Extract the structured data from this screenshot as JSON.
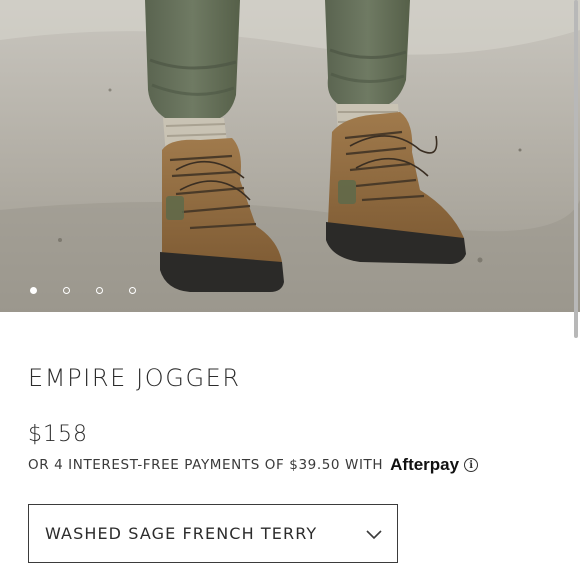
{
  "product": {
    "title": "EMPIRE JOGGER",
    "price": "$158",
    "installments_text": "OR 4 INTEREST-FREE PAYMENTS OF $39.50 WITH",
    "installments_provider": "Afterpay",
    "info_icon_glyph": "i"
  },
  "gallery": {
    "slide_count": 4,
    "active_slide": 1,
    "image_description_icon": "product-photo"
  },
  "variant": {
    "selected": "WASHED SAGE FRENCH TERRY",
    "icon": "chevron-down-icon"
  },
  "colors": {
    "text": "#2c2c2c",
    "border": "#3b3b3b",
    "background": "#ffffff"
  }
}
